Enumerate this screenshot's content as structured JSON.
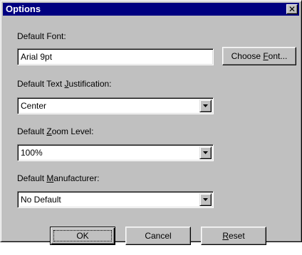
{
  "window": {
    "title": "Options",
    "close_glyph": "✕"
  },
  "font": {
    "label_pre": "Default Font:",
    "value": "Arial 9pt",
    "choose_pre": "Choose ",
    "choose_key": "F",
    "choose_post": "ont..."
  },
  "justification": {
    "label_pre": "Default Text ",
    "label_key": "J",
    "label_post": "ustification:",
    "value": "Center"
  },
  "zoom": {
    "label_pre": "Default ",
    "label_key": "Z",
    "label_post": "oom Level:",
    "value": "100%"
  },
  "manufacturer": {
    "label_pre": "Default ",
    "label_key": "M",
    "label_post": "anufacturer:",
    "value": "No Default"
  },
  "buttons": {
    "ok": "OK",
    "cancel": "Cancel",
    "reset_key": "R",
    "reset_post": "eset"
  },
  "colors": {
    "titlebar": "#000080",
    "face": "#c0c0c0",
    "field": "#ffffff"
  },
  "icons": {
    "dropdown": "chevron-down-icon",
    "close": "close-icon"
  }
}
